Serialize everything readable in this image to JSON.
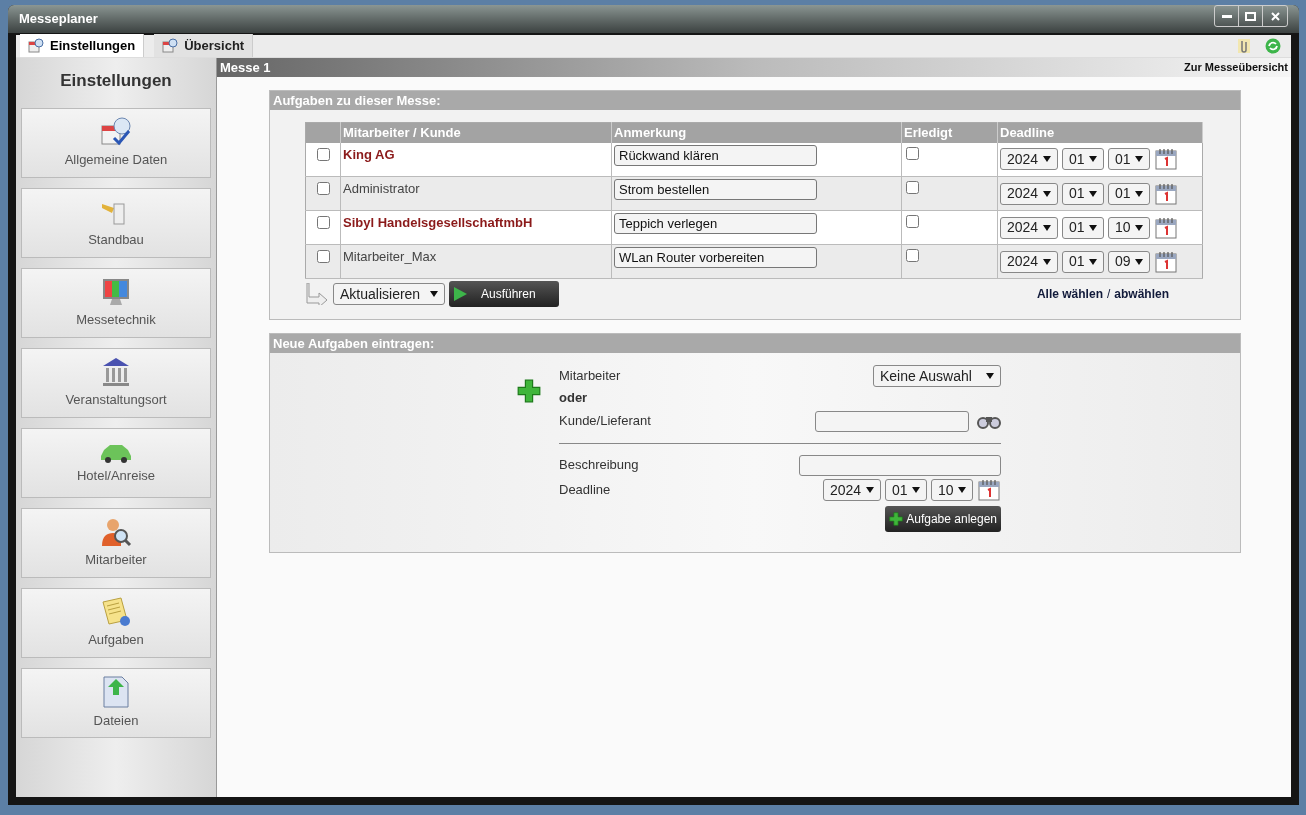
{
  "window": {
    "title": "Messeplaner"
  },
  "tabs": [
    {
      "label": "Einstellungen",
      "selected": true
    },
    {
      "label": "Übersicht",
      "selected": false
    }
  ],
  "sidebar": {
    "title": "Einstellungen",
    "items": [
      {
        "label": "Allgemeine Daten"
      },
      {
        "label": "Standbau"
      },
      {
        "label": "Messetechnik"
      },
      {
        "label": "Veranstaltungsort"
      },
      {
        "label": "Hotel/Anreise"
      },
      {
        "label": "Mitarbeiter"
      },
      {
        "label": "Aufgaben"
      },
      {
        "label": "Dateien"
      }
    ]
  },
  "header": {
    "title": "Messe 1",
    "link": "Zur Messeübersicht"
  },
  "tasks": {
    "title": "Aufgaben zu dieser Messe:",
    "columns": [
      "Mitarbeiter / Kunde",
      "Anmerkung",
      "Erledigt",
      "Deadline"
    ],
    "rows": [
      {
        "kind": "customer",
        "name": "King AG",
        "note": "Rückwand klären",
        "checked": false,
        "done": false,
        "year": "2024",
        "month": "01",
        "day": "01"
      },
      {
        "kind": "employee",
        "name": "Administrator",
        "note": "Strom bestellen",
        "checked": false,
        "done": false,
        "year": "2024",
        "month": "01",
        "day": "01"
      },
      {
        "kind": "customer",
        "name": "Sibyl HandelsgesellschaftmbH",
        "note": "Teppich verlegen",
        "checked": false,
        "done": false,
        "year": "2024",
        "month": "01",
        "day": "10"
      },
      {
        "kind": "employee",
        "name": "Mitarbeiter_Max",
        "note": "WLan Router vorbereiten",
        "checked": false,
        "done": false,
        "year": "2024",
        "month": "01",
        "day": "09"
      }
    ],
    "action": "Aktualisieren",
    "run_button": "Ausführen",
    "select_all": "Alle wählen",
    "separator": "/",
    "deselect_all": "abwählen"
  },
  "new_task": {
    "title": "Neue Aufgaben eintragen:",
    "employee_label": "Mitarbeiter",
    "employee_value": "Keine Auswahl",
    "or": "oder",
    "customer_label": "Kunde/Lieferant",
    "description_label": "Beschreibung",
    "deadline_label": "Deadline",
    "year": "2024",
    "month": "01",
    "day": "10",
    "submit": "Aufgabe anlegen"
  }
}
